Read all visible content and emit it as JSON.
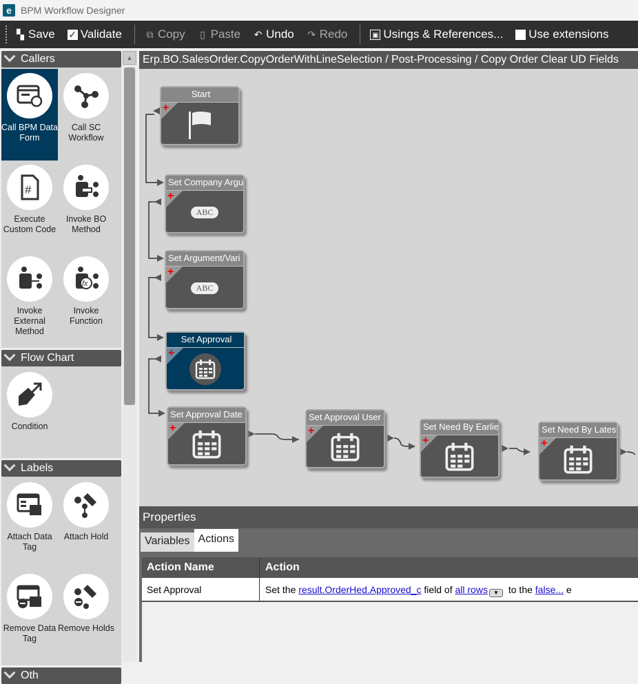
{
  "window": {
    "title": "BPM Workflow Designer",
    "logo": "e"
  },
  "toolbar": {
    "save": "Save",
    "validate": "Validate",
    "copy": "Copy",
    "paste": "Paste",
    "undo": "Undo",
    "redo": "Redo",
    "usings": "Usings & References...",
    "extensions": "Use extensions"
  },
  "sidebar": {
    "sections": [
      {
        "title": "Callers",
        "items": [
          {
            "label": "Call BPM Data Form"
          },
          {
            "label": "Call SC Workflow"
          },
          {
            "label": "Execute Custom Code"
          },
          {
            "label": "Invoke BO Method"
          },
          {
            "label": "Invoke External Method"
          },
          {
            "label": "Invoke Function"
          }
        ]
      },
      {
        "title": "Flow Chart",
        "items": [
          {
            "label": "Condition"
          }
        ]
      },
      {
        "title": "Labels",
        "items": [
          {
            "label": "Attach Data Tag"
          },
          {
            "label": "Attach Hold"
          },
          {
            "label": "Remove Data Tag"
          },
          {
            "label": "Remove Holds"
          }
        ]
      },
      {
        "title": "Oth"
      }
    ]
  },
  "breadcrumb": "Erp.BO.SalesOrder.CopyOrderWithLineSelection / Post-Processing / Copy Order Clear UD Fields",
  "canvas": {
    "nodes": [
      {
        "label": "Start",
        "icon": "flag-icon"
      },
      {
        "label": "Set Company Argu",
        "icon": "abc-icon",
        "badge": "ABC"
      },
      {
        "label": "Set Argument/Vari",
        "icon": "abc-icon",
        "badge": "ABC"
      },
      {
        "label": "Set Approval",
        "icon": "calendar-icon",
        "selected": true
      },
      {
        "label": "Set Approval Date",
        "icon": "calendar-icon"
      },
      {
        "label": "Set Approval User",
        "icon": "calendar-icon"
      },
      {
        "label": "Set Need By Earlies",
        "icon": "calendar-icon"
      },
      {
        "label": "Set Need By Latest",
        "icon": "calendar-icon"
      }
    ]
  },
  "properties": {
    "title": "Properties",
    "tabs": [
      "Variables",
      "Actions"
    ],
    "active_tab": "Actions",
    "columns": [
      "Action Name",
      "Action"
    ],
    "rows": [
      {
        "name": "Set Approval",
        "a1": "Set the ",
        "field": "result.OrderHed.Approved_c",
        "a2": " field of ",
        "rows": "all rows",
        "a3": " to the ",
        "value": "false...",
        "a4": " e"
      }
    ]
  },
  "colors": {
    "selected": "#003a5c",
    "toolbar": "#2f2f2f",
    "link": "#1a0dcc"
  }
}
